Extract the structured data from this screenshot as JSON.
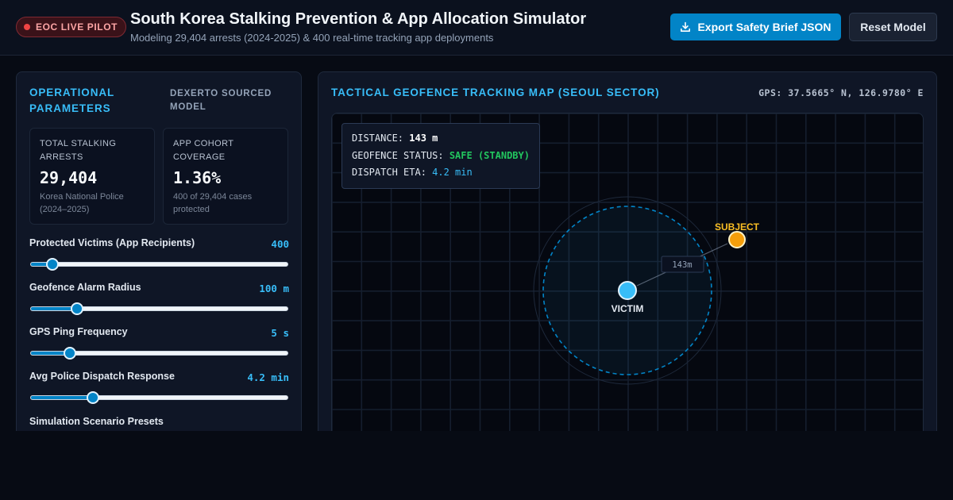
{
  "header": {
    "badge": "EOC LIVE PILOT",
    "title": "South Korea Stalking Prevention & App Allocation Simulator",
    "subtitle": "Modeling 29,404 arrests (2024-2025) & 400 real-time tracking app deployments",
    "export_label": "Export Safety Brief JSON",
    "reset_label": "Reset Model"
  },
  "params_panel": {
    "title": "OPERATIONAL PARAMETERS",
    "source": "DEXERTO SOURCED MODEL",
    "stats": [
      {
        "label": "TOTAL STALKING ARRESTS",
        "value": "29,404",
        "sub": "Korea National Police (2024–2025)"
      },
      {
        "label": "APP COHORT COVERAGE",
        "value": "1.36%",
        "sub": "400 of 29,404 cases protected"
      }
    ],
    "sliders": [
      {
        "label": "Protected Victims (App Recipients)",
        "value": "400",
        "fill": 0.09
      },
      {
        "label": "Geofence Alarm Radius",
        "value": "100 m",
        "fill": 0.185
      },
      {
        "label": "GPS Ping Frequency",
        "value": "5 s",
        "fill": 0.155
      },
      {
        "label": "Avg Police Dispatch Response",
        "value": "4.2 min",
        "fill": 0.245
      }
    ],
    "presets_title": "Simulation Scenario Presets"
  },
  "map_panel": {
    "title": "TACTICAL GEOFENCE TRACKING MAP (SEOUL SECTOR)",
    "gps": "GPS: 37.5665° N, 126.9780° E",
    "info": {
      "distance_label": "DISTANCE:",
      "distance_value": "143 m",
      "status_label": "GEOFENCE STATUS:",
      "status_value": "SAFE (STANDBY)",
      "eta_label": "DISPATCH ETA:",
      "eta_value": "4.2 min"
    },
    "victim_label": "VICTIM",
    "subject_label": "SUBJECT",
    "distance_tag": "143m",
    "colors": {
      "victim": "#38bdf8",
      "subject": "#f59e0b",
      "safe": "#22c55e",
      "accent": "#0284c7"
    }
  }
}
